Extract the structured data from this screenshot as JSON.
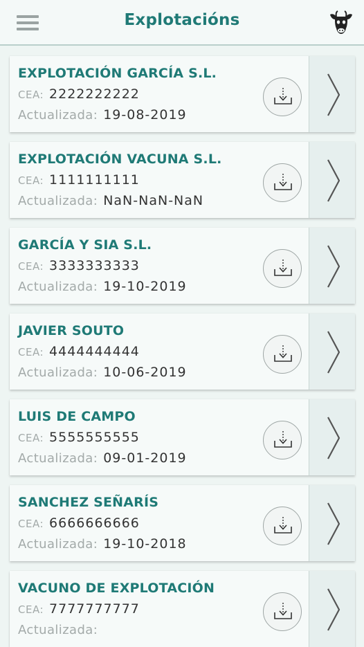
{
  "header": {
    "title": "Explotacións",
    "menu_icon": "hamburger-menu-icon",
    "cow_icon": "cow-head-icon"
  },
  "labels": {
    "cea": "CEA:",
    "updated": "Actualizada:"
  },
  "farms": [
    {
      "name": "EXPLOTACIÓN GARCÍA S.L.",
      "cea": "2222222222",
      "updated": "19-08-2019"
    },
    {
      "name": "EXPLOTACIÓN VACUNA S.L.",
      "cea": "1111111111",
      "updated": "NaN-NaN-NaN"
    },
    {
      "name": "GARCÍA Y SIA S.L.",
      "cea": "3333333333",
      "updated": "19-10-2019"
    },
    {
      "name": "JAVIER SOUTO",
      "cea": "4444444444",
      "updated": "10-06-2019"
    },
    {
      "name": "LUIS DE CAMPO",
      "cea": "5555555555",
      "updated": "09-01-2019"
    },
    {
      "name": "SANCHEZ SEÑARÍS",
      "cea": "6666666666",
      "updated": "19-10-2018"
    },
    {
      "name": "VACUNO DE EXPLOTACIÓN",
      "cea": "7777777777",
      "updated": ""
    }
  ],
  "colors": {
    "accent": "#1f7a76",
    "background": "#eef5f3",
    "card": "#f6faf9",
    "label_gray": "#a3aaa9"
  }
}
